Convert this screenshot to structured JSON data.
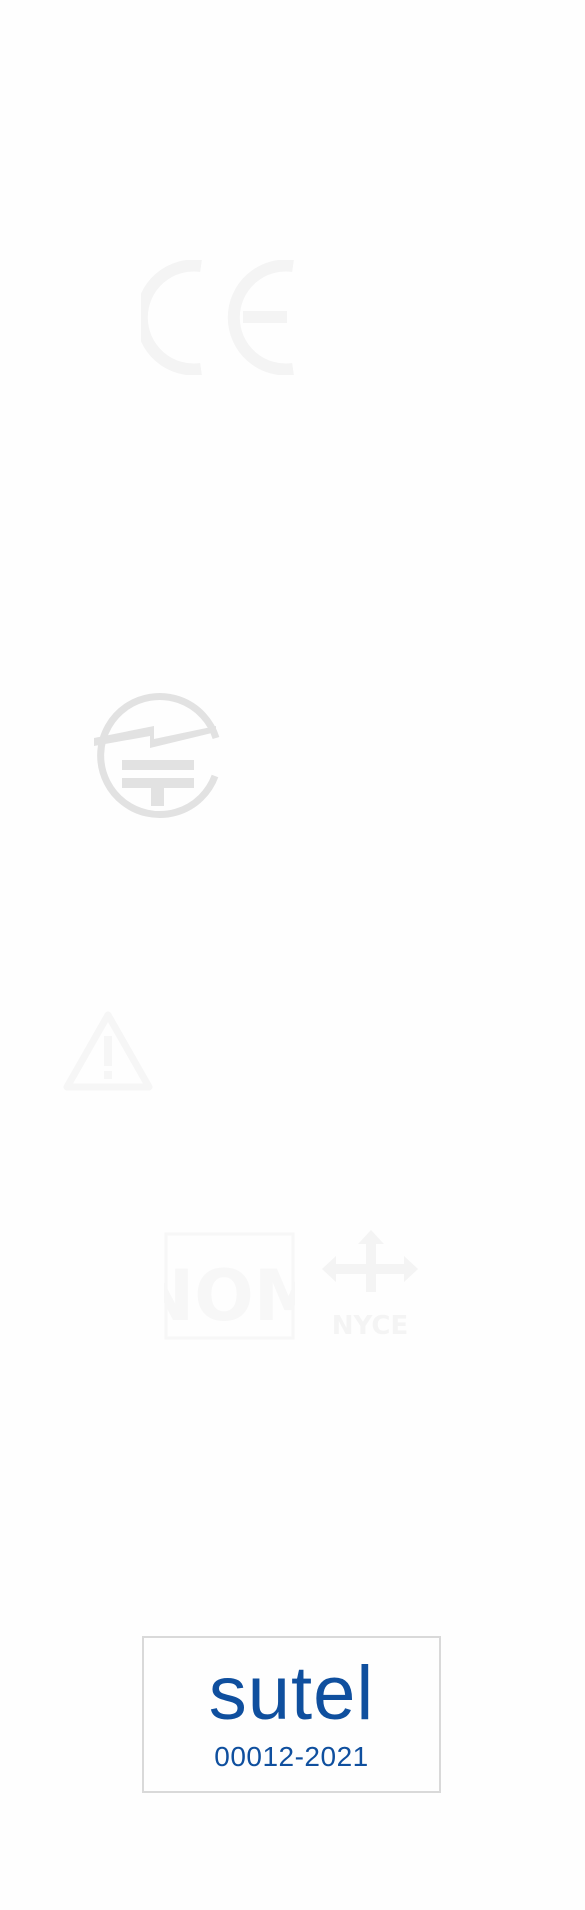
{
  "marks": {
    "ce": {
      "icon": "ce-mark-icon",
      "text": "CE",
      "color": "#f4f4f4"
    },
    "telec": {
      "icon": "telec-giteki-mark-icon",
      "color": "#e2e2e2"
    },
    "warning": {
      "icon": "warning-triangle-icon",
      "color": "#f6f6f6"
    },
    "nom": {
      "icon": "nom-mark-icon",
      "text": "NOM",
      "color": "#f7f7f7"
    },
    "nyce": {
      "icon": "nyce-mark-icon",
      "text": "NYCE",
      "color": "#f4f4f4"
    }
  },
  "sutel": {
    "name": "sutel",
    "code": "00012-2021",
    "color": "#0f4f9e",
    "border_color": "#d9d9d9"
  }
}
